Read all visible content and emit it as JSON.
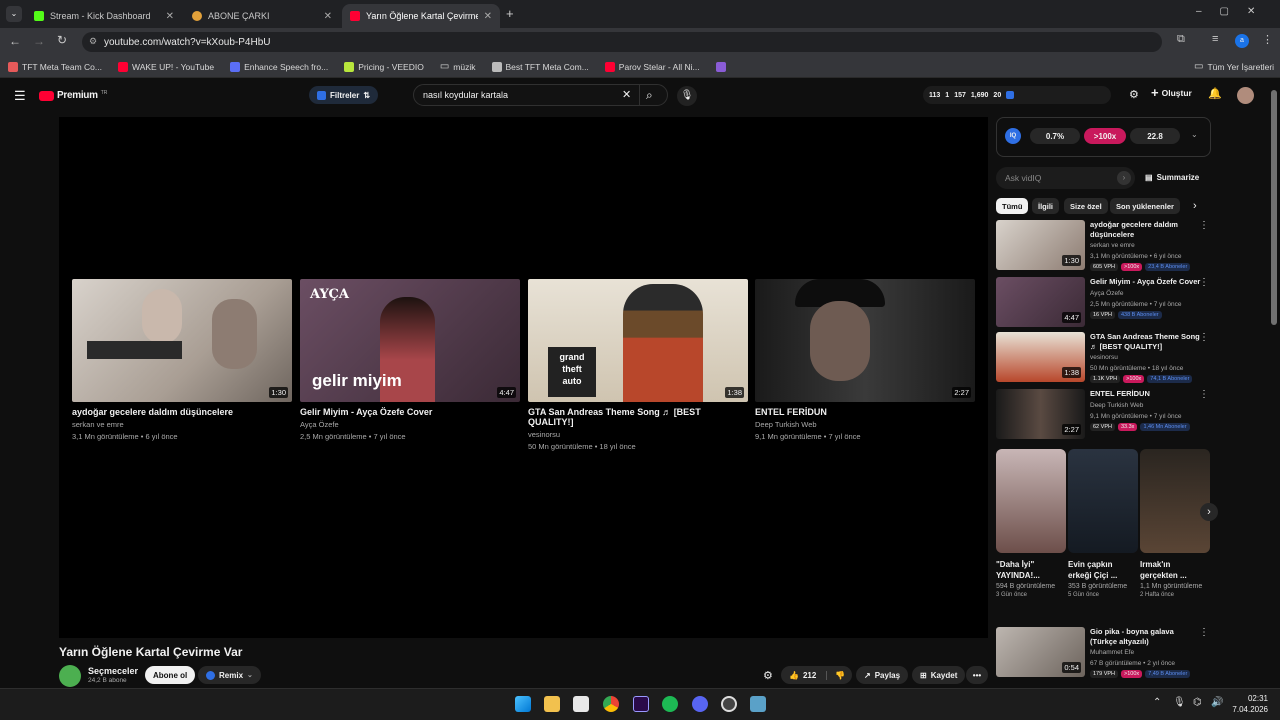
{
  "browser": {
    "tabs": [
      {
        "title": "Stream - Kick Dashboard",
        "color": "#53fc18"
      },
      {
        "title": "ABONE ÇARKI",
        "color": "#e2a13a"
      },
      {
        "title": "Yarın Öğlene Kartal Çevirme Var",
        "color": "#ff0033"
      }
    ],
    "url": "youtube.com/watch?v=kXoub-P4HbU",
    "bookmarks": [
      "TFT Meta Team Co...",
      "WAKE UP! - YouTube",
      "Enhance Speech fro...",
      "Pricing - VEEDIO",
      "müzik",
      "Best TFT Meta Com...",
      "Parov Stelar - All Ni..."
    ],
    "bookmarks_right": "Tüm Yer İşaretleri"
  },
  "yt": {
    "logo": "Premium",
    "region": "TR",
    "filters": "Filtreler",
    "search_value": "nasıl koydular kartala",
    "stats": [
      "113",
      "1",
      "157",
      "1,690",
      "20"
    ],
    "create": "Oluştur"
  },
  "endcards": [
    {
      "title": "aydoğar gecelere daldım düşüncelere",
      "channel": "serkan ve emre",
      "meta": "3,1 Mn görüntüleme • 6 yıl önce",
      "duration": "1:30"
    },
    {
      "title": "Gelir Miyim - Ayça Özefe Cover",
      "channel": "Ayça Özefe",
      "meta": "2,5 Mn görüntüleme • 7 yıl önce",
      "duration": "4:47",
      "overlay": "gelir miyim",
      "logo": "AYÇA"
    },
    {
      "title": "GTA San Andreas Theme Song ♬ [BEST QUALITY!]",
      "channel": "vesinorsu",
      "meta": "50 Mn görüntüleme • 18 yıl önce",
      "duration": "1:38"
    },
    {
      "title": "ENTEL FERİDUN",
      "channel": "Deep Turkish Web",
      "meta": "9,1 Mn görüntüleme • 7 yıl önce",
      "duration": "2:27"
    }
  ],
  "video": {
    "title": "Yarın Öğlene Kartal Çevirme Var",
    "channel": "Seçmeceler",
    "subs": "24,2 B abone",
    "subscribe": "Abone ol",
    "remix": "Remix",
    "likes": "212",
    "share": "Paylaş",
    "save": "Kaydet"
  },
  "vidiq": {
    "score1": "0.7%",
    "score2": ">100x",
    "score3": "22.8",
    "ask_placeholder": "Ask vidIQ",
    "summarize": "Summarize"
  },
  "chips": [
    "Tümü",
    "İlgili",
    "Size özel",
    "Son yüklenenler"
  ],
  "sidebar": [
    {
      "title": "aydoğar gecelere daldım düşüncelere",
      "channel": "serkan ve emre",
      "meta": "3,1 Mn görüntüleme • 6 yıl önce",
      "vph": "605 VPH",
      "mult": ">100x",
      "subs": "23,4 B Aboneler",
      "duration": "1:30"
    },
    {
      "title": "Gelir Miyim - Ayça Özefe Cover",
      "channel": "Ayça Özefe",
      "meta": "2,5 Mn görüntüleme • 7 yıl önce",
      "vph": "16 VPH",
      "mult": "",
      "subs": "438 B Aboneler",
      "duration": "4:47"
    },
    {
      "title": "GTA San Andreas Theme Song ♬ [BEST QUALITY!]",
      "channel": "vesinorsu",
      "meta": "50 Mn görüntüleme • 18 yıl önce",
      "vph": "1.1K VPH",
      "mult": ">100x",
      "subs": "74,1 B Aboneler",
      "duration": "1:38"
    },
    {
      "title": "ENTEL FERİDUN",
      "channel": "Deep Turkish Web",
      "meta": "9,1 Mn görüntüleme • 7 yıl önce",
      "vph": "62 VPH",
      "mult": "33.3x",
      "subs": "1,46 Mn Aboneler",
      "duration": "2:27"
    }
  ],
  "shorts": [
    {
      "title": "\"Daha İyi\" YAYINDA!...",
      "views": "594 B görüntüleme",
      "ago": "3 Gün önce"
    },
    {
      "title": "Evin çapkın erkeği Çiçi ...",
      "views": "353 B görüntüleme",
      "ago": "5 Gün önce"
    },
    {
      "title": "Irmak'ın gerçekten ...",
      "views": "1,1 Mn görüntüleme",
      "ago": "2 Hafta önce"
    }
  ],
  "sidebar_last": {
    "title": "Gio pika - boyna galava (Türkçe altyazılı)",
    "channel": "Muhammet Efe",
    "meta": "67 B görüntüleme • 2 yıl önce",
    "vph": "179 VPH",
    "mult": ">100x",
    "subs": "7,49 B Aboneler",
    "duration": "0:54"
  },
  "clock": {
    "time": "02:31",
    "date": "7.04.2026"
  }
}
